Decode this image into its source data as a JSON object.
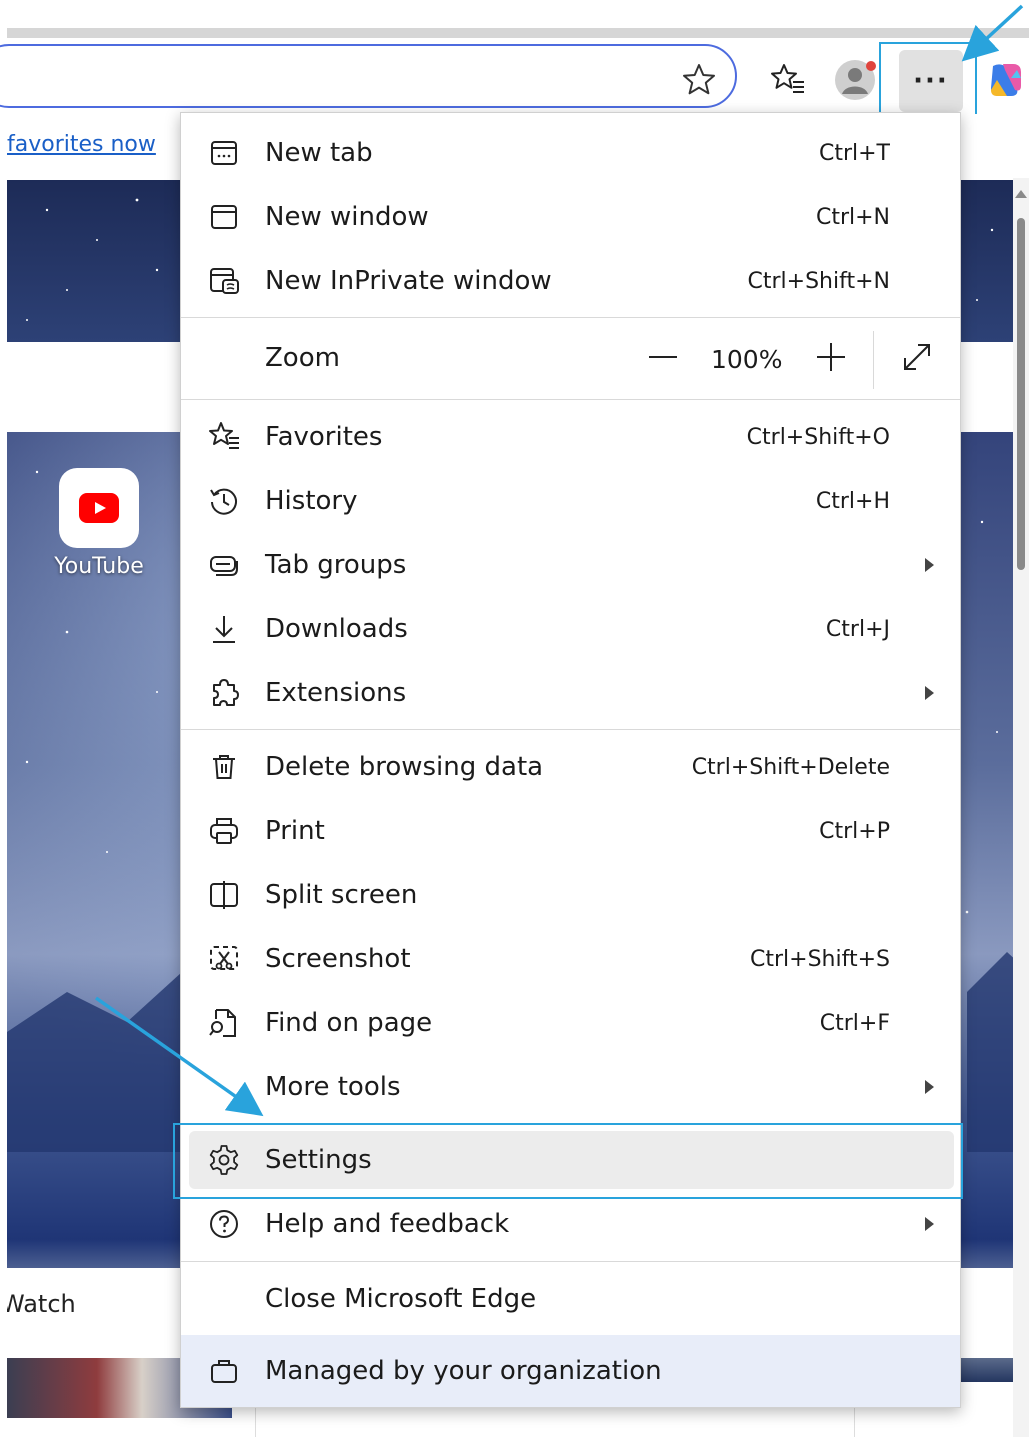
{
  "toolbar": {
    "more_label": "···"
  },
  "page": {
    "favorites_link": "favorites now",
    "shortcut_youtube": "YouTube",
    "watch_label": "Watch"
  },
  "menu": {
    "items_top": [
      {
        "label": "New tab",
        "shortcut": "Ctrl+T",
        "icon": "new-tab-icon"
      },
      {
        "label": "New window",
        "shortcut": "Ctrl+N",
        "icon": "new-window-icon"
      },
      {
        "label": "New InPrivate window",
        "shortcut": "Ctrl+Shift+N",
        "icon": "inprivate-icon"
      }
    ],
    "zoom": {
      "label": "Zoom",
      "value": "100%"
    },
    "items_mid": [
      {
        "label": "Favorites",
        "shortcut": "Ctrl+Shift+O",
        "icon": "favorites-icon"
      },
      {
        "label": "History",
        "shortcut": "Ctrl+H",
        "icon": "history-icon"
      },
      {
        "label": "Tab groups",
        "shortcut": "",
        "icon": "tab-groups-icon",
        "submenu": true
      },
      {
        "label": "Downloads",
        "shortcut": "Ctrl+J",
        "icon": "download-icon"
      },
      {
        "label": "Extensions",
        "shortcut": "",
        "icon": "extensions-icon",
        "submenu": true
      }
    ],
    "items_tools": [
      {
        "label": "Delete browsing data",
        "shortcut": "Ctrl+Shift+Delete",
        "icon": "trash-icon"
      },
      {
        "label": "Print",
        "shortcut": "Ctrl+P",
        "icon": "printer-icon"
      },
      {
        "label": "Split screen",
        "shortcut": "",
        "icon": "split-screen-icon"
      },
      {
        "label": "Screenshot",
        "shortcut": "Ctrl+Shift+S",
        "icon": "screenshot-icon"
      },
      {
        "label": "Find on page",
        "shortcut": "Ctrl+F",
        "icon": "find-icon"
      },
      {
        "label": "More tools",
        "shortcut": "",
        "icon": "",
        "submenu": true
      }
    ],
    "settings": {
      "label": "Settings",
      "icon": "gear-icon"
    },
    "help": {
      "label": "Help and feedback",
      "icon": "help-icon",
      "submenu": true
    },
    "close": {
      "label": "Close Microsoft Edge"
    },
    "managed": {
      "label": "Managed by your organization",
      "icon": "briefcase-icon"
    }
  },
  "colors": {
    "accent_blue": "#4d6bdf",
    "highlight_box": "#29a3dc",
    "managed_bg": "#e8edf9"
  }
}
